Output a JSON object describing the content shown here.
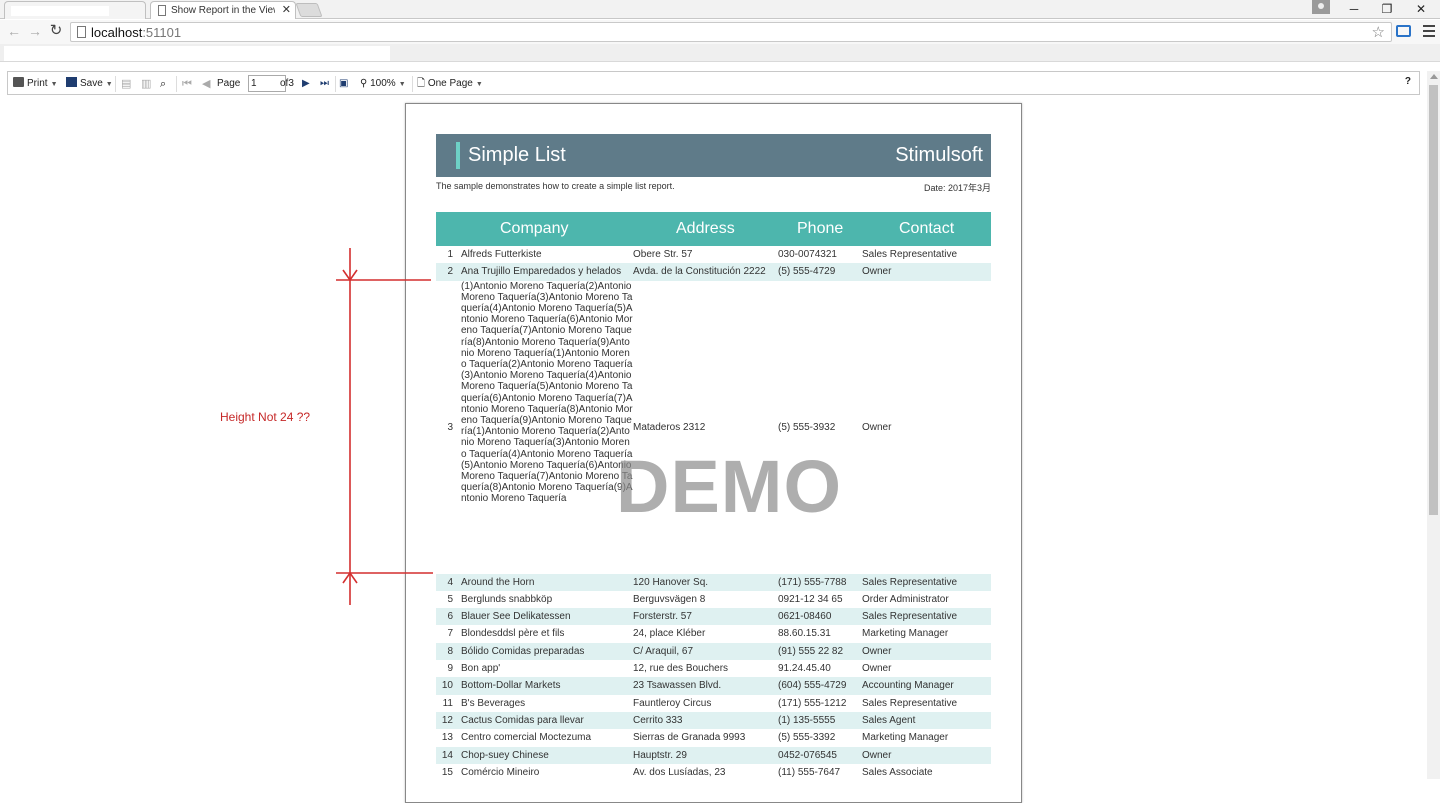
{
  "browser": {
    "active_tab_title": "Show Report in the Viewer",
    "tab_close": "✕",
    "url_host": "localhost",
    "url_port": ":51101",
    "win_minimize": "─",
    "win_restore": "❐",
    "win_close": "✕"
  },
  "toolbar": {
    "print_label": "Print",
    "save_label": "Save",
    "page_label": "Page",
    "page_value": "1",
    "page_of": "of3",
    "zoom_label": "100%",
    "view_mode_label": "One Page",
    "help_label": "?"
  },
  "report": {
    "title": "Simple List",
    "brand": "Stimulsoft",
    "description": "The sample demonstrates how to create a simple list report.",
    "date": "Date: 2017年3月",
    "columns": [
      "Company",
      "Address",
      "Phone",
      "Contact"
    ],
    "watermark": "DEMO",
    "rows": [
      {
        "num": "1",
        "company": "Alfreds Futterkiste",
        "address": "Obere Str. 57",
        "phone": "030-0074321",
        "contact": "Sales Representative"
      },
      {
        "num": "2",
        "company": "Ana Trujillo Emparedados y helados",
        "address": "Avda. de la Constitución 2222",
        "phone": "(5) 555-4729",
        "contact": "Owner"
      },
      {
        "num": "3",
        "company": "(1)Antonio Moreno Taquería(2)Antonio Moreno Taquería(3)Antonio Moreno Taquería(4)Antonio Moreno Taquería(5)Antonio Moreno Taquería(6)Antonio Moreno Taquería(7)Antonio Moreno Taquería(8)Antonio Moreno Taquería(9)Antonio Moreno Taquería(1)Antonio Moreno Taquería(2)Antonio Moreno Taquería(3)Antonio Moreno Taquería(4)Antonio Moreno Taquería(5)Antonio Moreno Taquería(6)Antonio Moreno Taquería(7)Antonio Moreno Taquería(8)Antonio Moreno Taquería(9)Antonio Moreno Taquería(1)Antonio Moreno Taquería(2)Antonio Moreno Taquería(3)Antonio Moreno Taquería(4)Antonio Moreno Taquería(5)Antonio Moreno Taquería(6)Antonio Moreno Taquería(7)Antonio Moreno Taquería(8)Antonio Moreno Taquería(9)Antonio Moreno Taquería",
        "address": "Mataderos 2312",
        "phone": "(5) 555-3932",
        "contact": "Owner"
      },
      {
        "num": "4",
        "company": "Around the Horn",
        "address": "120 Hanover Sq.",
        "phone": "(171) 555-7788",
        "contact": "Sales Representative"
      },
      {
        "num": "5",
        "company": "Berglunds snabbköp",
        "address": "Berguvsvägen 8",
        "phone": "0921-12 34 65",
        "contact": "Order Administrator"
      },
      {
        "num": "6",
        "company": "Blauer See Delikatessen",
        "address": "Forsterstr. 57",
        "phone": "0621-08460",
        "contact": "Sales Representative"
      },
      {
        "num": "7",
        "company": "Blondesddsl père et fils",
        "address": "24, place Kléber",
        "phone": "88.60.15.31",
        "contact": "Marketing Manager"
      },
      {
        "num": "8",
        "company": "Bólido Comidas preparadas",
        "address": "C/ Araquil, 67",
        "phone": "(91) 555 22 82",
        "contact": "Owner"
      },
      {
        "num": "9",
        "company": "Bon app'",
        "address": "12, rue des Bouchers",
        "phone": "91.24.45.40",
        "contact": "Owner"
      },
      {
        "num": "10",
        "company": "Bottom-Dollar Markets",
        "address": "23 Tsawassen Blvd.",
        "phone": "(604) 555-4729",
        "contact": "Accounting Manager"
      },
      {
        "num": "11",
        "company": "B's Beverages",
        "address": "Fauntleroy Circus",
        "phone": "(171) 555-1212",
        "contact": "Sales Representative"
      },
      {
        "num": "12",
        "company": "Cactus Comidas para llevar",
        "address": "Cerrito 333",
        "phone": "(1) 135-5555",
        "contact": "Sales Agent"
      },
      {
        "num": "13",
        "company": "Centro comercial Moctezuma",
        "address": "Sierras de Granada 9993",
        "phone": "(5) 555-3392",
        "contact": "Marketing Manager"
      },
      {
        "num": "14",
        "company": "Chop-suey Chinese",
        "address": "Hauptstr. 29",
        "phone": "0452-076545",
        "contact": "Owner"
      },
      {
        "num": "15",
        "company": "Comércio Mineiro",
        "address": "Av. dos Lusíadas, 23",
        "phone": "(11) 555-7647",
        "contact": "Sales Associate"
      }
    ]
  },
  "annotation": {
    "label": "Height Not 24 ??",
    "color": "#d32f2f"
  }
}
